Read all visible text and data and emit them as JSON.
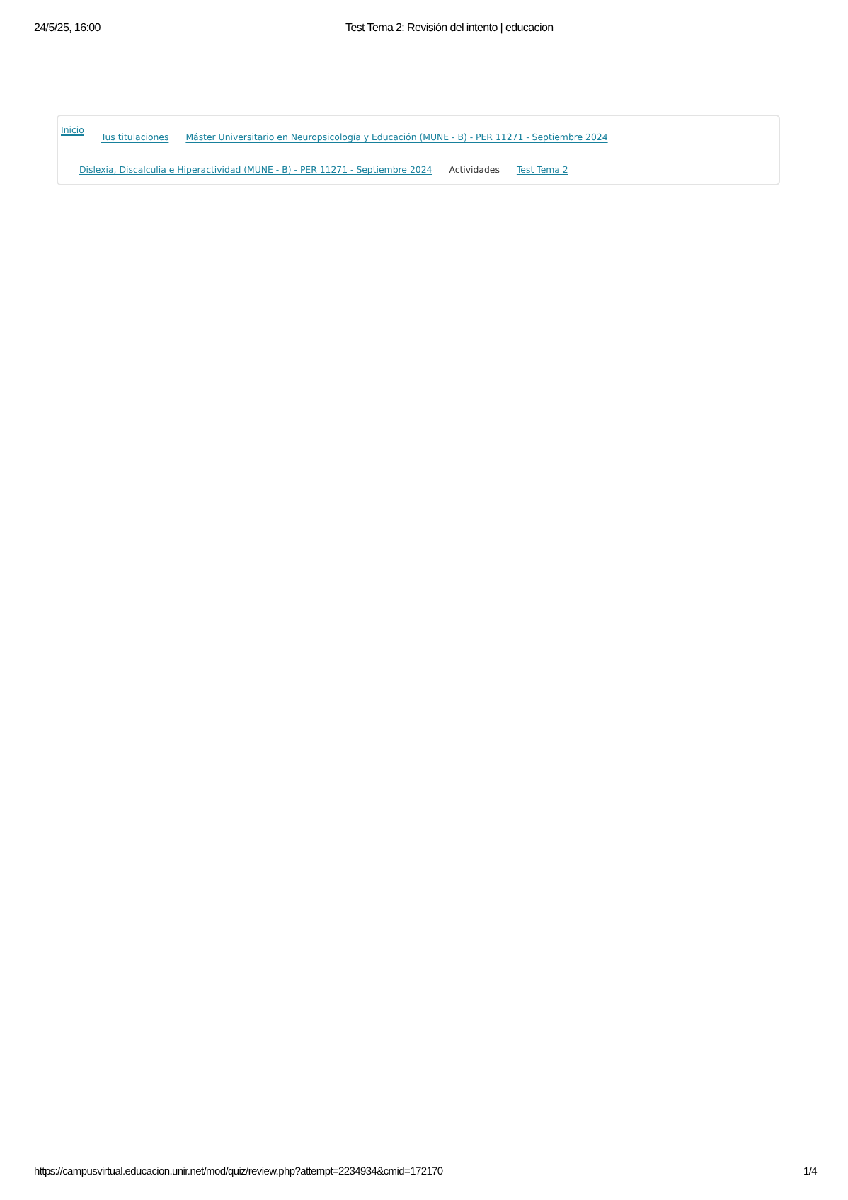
{
  "print_header": {
    "date": "24/5/25, 16:00",
    "title": "Test Tema 2: Revisión del intento | educacion"
  },
  "breadcrumb": [
    {
      "label": "Inicio",
      "kind": "link"
    },
    {
      "label": "Tus titulaciones",
      "kind": "link"
    },
    {
      "label": "Máster Universitario en Neuropsicología y Educación (MUNE - B) - PER 11271 - Septiembre 2024",
      "kind": "link"
    },
    {
      "label": "Dislexia, Discalculia e Hiperactividad (MUNE - B) - PER 11271 - Septiembre 2024",
      "kind": "link"
    },
    {
      "label": "Actividades",
      "kind": "text"
    },
    {
      "label": "Test Tema 2",
      "kind": "link"
    }
  ],
  "print_footer": {
    "url": "https://campusvirtual.educacion.unir.net/mod/quiz/review.php?attempt=2234934&cmid=172170",
    "page": "1/4"
  }
}
